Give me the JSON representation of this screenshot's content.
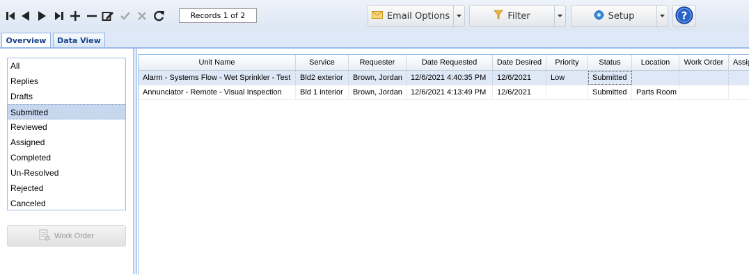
{
  "toolbar": {
    "icons": [
      "first-record-icon",
      "previous-record-icon",
      "next-record-icon",
      "last-record-icon",
      "add-icon",
      "remove-icon",
      "edit-icon",
      "save-check-icon",
      "cancel-x-icon",
      "refresh-icon"
    ],
    "records_label": "Records 1 of 2",
    "email_options_label": "Email Options",
    "filter_label": "Filter",
    "setup_label": "Setup"
  },
  "tabs": [
    {
      "label": "Overview",
      "active": true
    },
    {
      "label": "Data View",
      "active": false
    }
  ],
  "status_filters": [
    {
      "label": "All",
      "selected": false
    },
    {
      "label": "Replies",
      "selected": false
    },
    {
      "label": "Drafts",
      "selected": false
    },
    {
      "label": "Submitted",
      "selected": true
    },
    {
      "label": "Reviewed",
      "selected": false
    },
    {
      "label": "Assigned",
      "selected": false
    },
    {
      "label": "Completed",
      "selected": false
    },
    {
      "label": "Un-Resolved",
      "selected": false
    },
    {
      "label": "Rejected",
      "selected": false
    },
    {
      "label": "Canceled",
      "selected": false
    }
  ],
  "work_order_button": {
    "label": "Work Order",
    "enabled": false
  },
  "grid": {
    "columns": [
      "Unit Name",
      "Service",
      "Requester",
      "Date Requested",
      "Date Desired",
      "Priority",
      "Status",
      "Location",
      "Work Order",
      "Assig"
    ],
    "rows": [
      {
        "selected": true,
        "cells": [
          "Alarm - Systems Flow - Wet Sprinkler - Test",
          "Bld2 exterior",
          "Brown, Jordan",
          "12/6/2021 4:40:35 PM",
          "12/6/2021",
          "Low",
          "Submitted",
          "",
          "",
          ""
        ]
      },
      {
        "selected": false,
        "cells": [
          "Annunciator - Remote - Visual Inspection",
          "Bld 1 interior",
          "Brown, Jordan",
          "12/6/2021 4:13:49 PM",
          "12/6/2021",
          "",
          "Submitted",
          "Parts Room",
          "",
          ""
        ]
      }
    ]
  },
  "colors": {
    "accent_blue": "#15428b",
    "border_blue": "#99bbe8",
    "selected_row": "#dfe8f6",
    "selected_filter": "#c6d7ee"
  }
}
